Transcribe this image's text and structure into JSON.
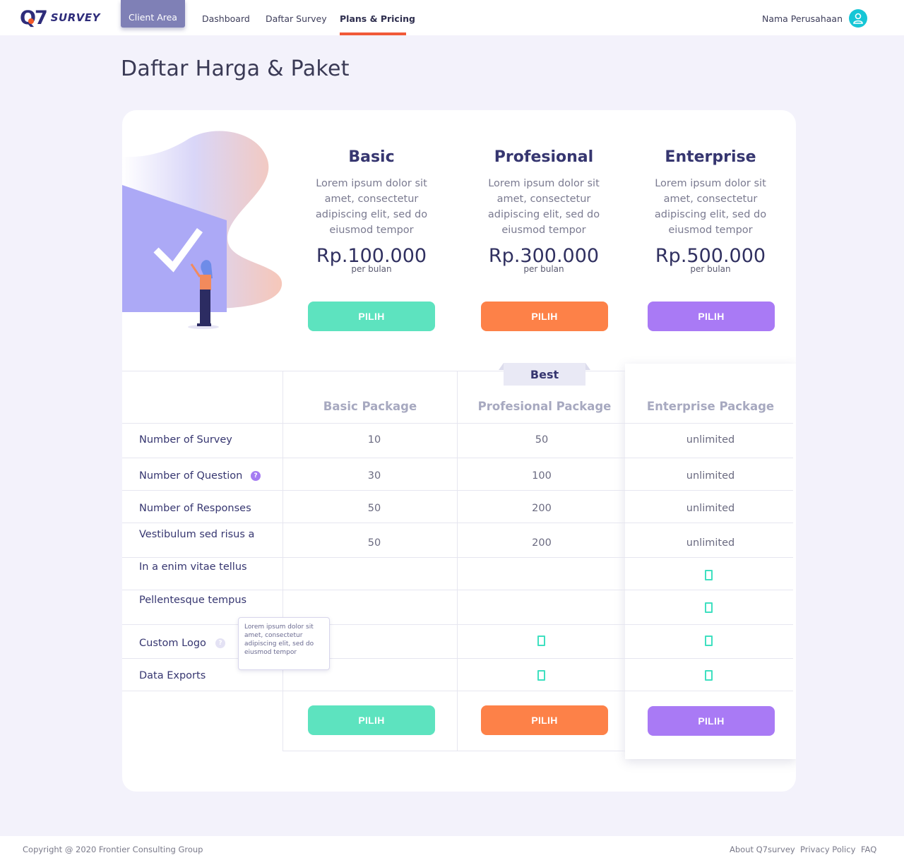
{
  "header": {
    "logo_mark": "Q7",
    "logo_text": "SURVEY",
    "client_area": "Client Area",
    "nav": [
      "Dashboard",
      "Daftar Survey",
      "Plans & Pricing"
    ],
    "company": "Nama Perusahaan",
    "avatar_icon": "user-icon"
  },
  "page_title": "Daftar Harga & Paket",
  "plans": [
    {
      "name": "Basic",
      "desc": "Lorem ipsum dolor sit amet, consectetur adipiscing elit, sed do eiusmod tempor",
      "price": "Rp.100.000",
      "period": "per bulan",
      "button": "PILIH",
      "color": "#5de3bf"
    },
    {
      "name": "Profesional",
      "desc": "Lorem ipsum dolor sit amet, consectetur adipiscing elit, sed do eiusmod tempor",
      "price": "Rp.300.000",
      "period": "per bulan",
      "button": "PILIH",
      "color": "#fd8148"
    },
    {
      "name": "Enterprise",
      "desc": "Lorem ipsum dolor sit amet, consectetur adipiscing elit, sed do eiusmod tempor",
      "price": "Rp.500.000",
      "period": "per bulan",
      "button": "PILIH",
      "color": "#a97af5"
    }
  ],
  "table": {
    "best_label": "Best",
    "columns": [
      "Basic Package",
      "Profesional Package",
      "Enterprise Package"
    ],
    "rows": [
      {
        "label": "Number of Survey",
        "values": [
          "10",
          "50",
          "unlimited"
        ]
      },
      {
        "label": "Number of Question",
        "values": [
          "30",
          "100",
          "unlimited"
        ],
        "help": "?"
      },
      {
        "label": "Number of Responses",
        "values": [
          "50",
          "200",
          "unlimited"
        ]
      },
      {
        "label": "Vestibulum sed risus a",
        "values": [
          "50",
          "200",
          "unlimited"
        ]
      },
      {
        "label": "In a enim vitae tellus",
        "checks": [
          false,
          false,
          true
        ]
      },
      {
        "label": "Pellentesque tempus",
        "checks": [
          false,
          false,
          true
        ]
      },
      {
        "label": "Custom Logo",
        "checks": [
          false,
          true,
          true
        ],
        "help": "?"
      },
      {
        "label": "Data Exports",
        "checks": [
          false,
          true,
          true
        ]
      }
    ],
    "tooltip": "Lorem ipsum dolor sit amet, consectetur adipiscing elit, sed do eiusmod tempor",
    "bottom_buttons": [
      "PILIH",
      "PILIH",
      "PILIH"
    ]
  },
  "footer": {
    "copyright": "Copyright @ 2020 Frontier Consulting Group",
    "links": [
      "About Q7survey",
      "Privacy Policy",
      "FAQ"
    ]
  }
}
